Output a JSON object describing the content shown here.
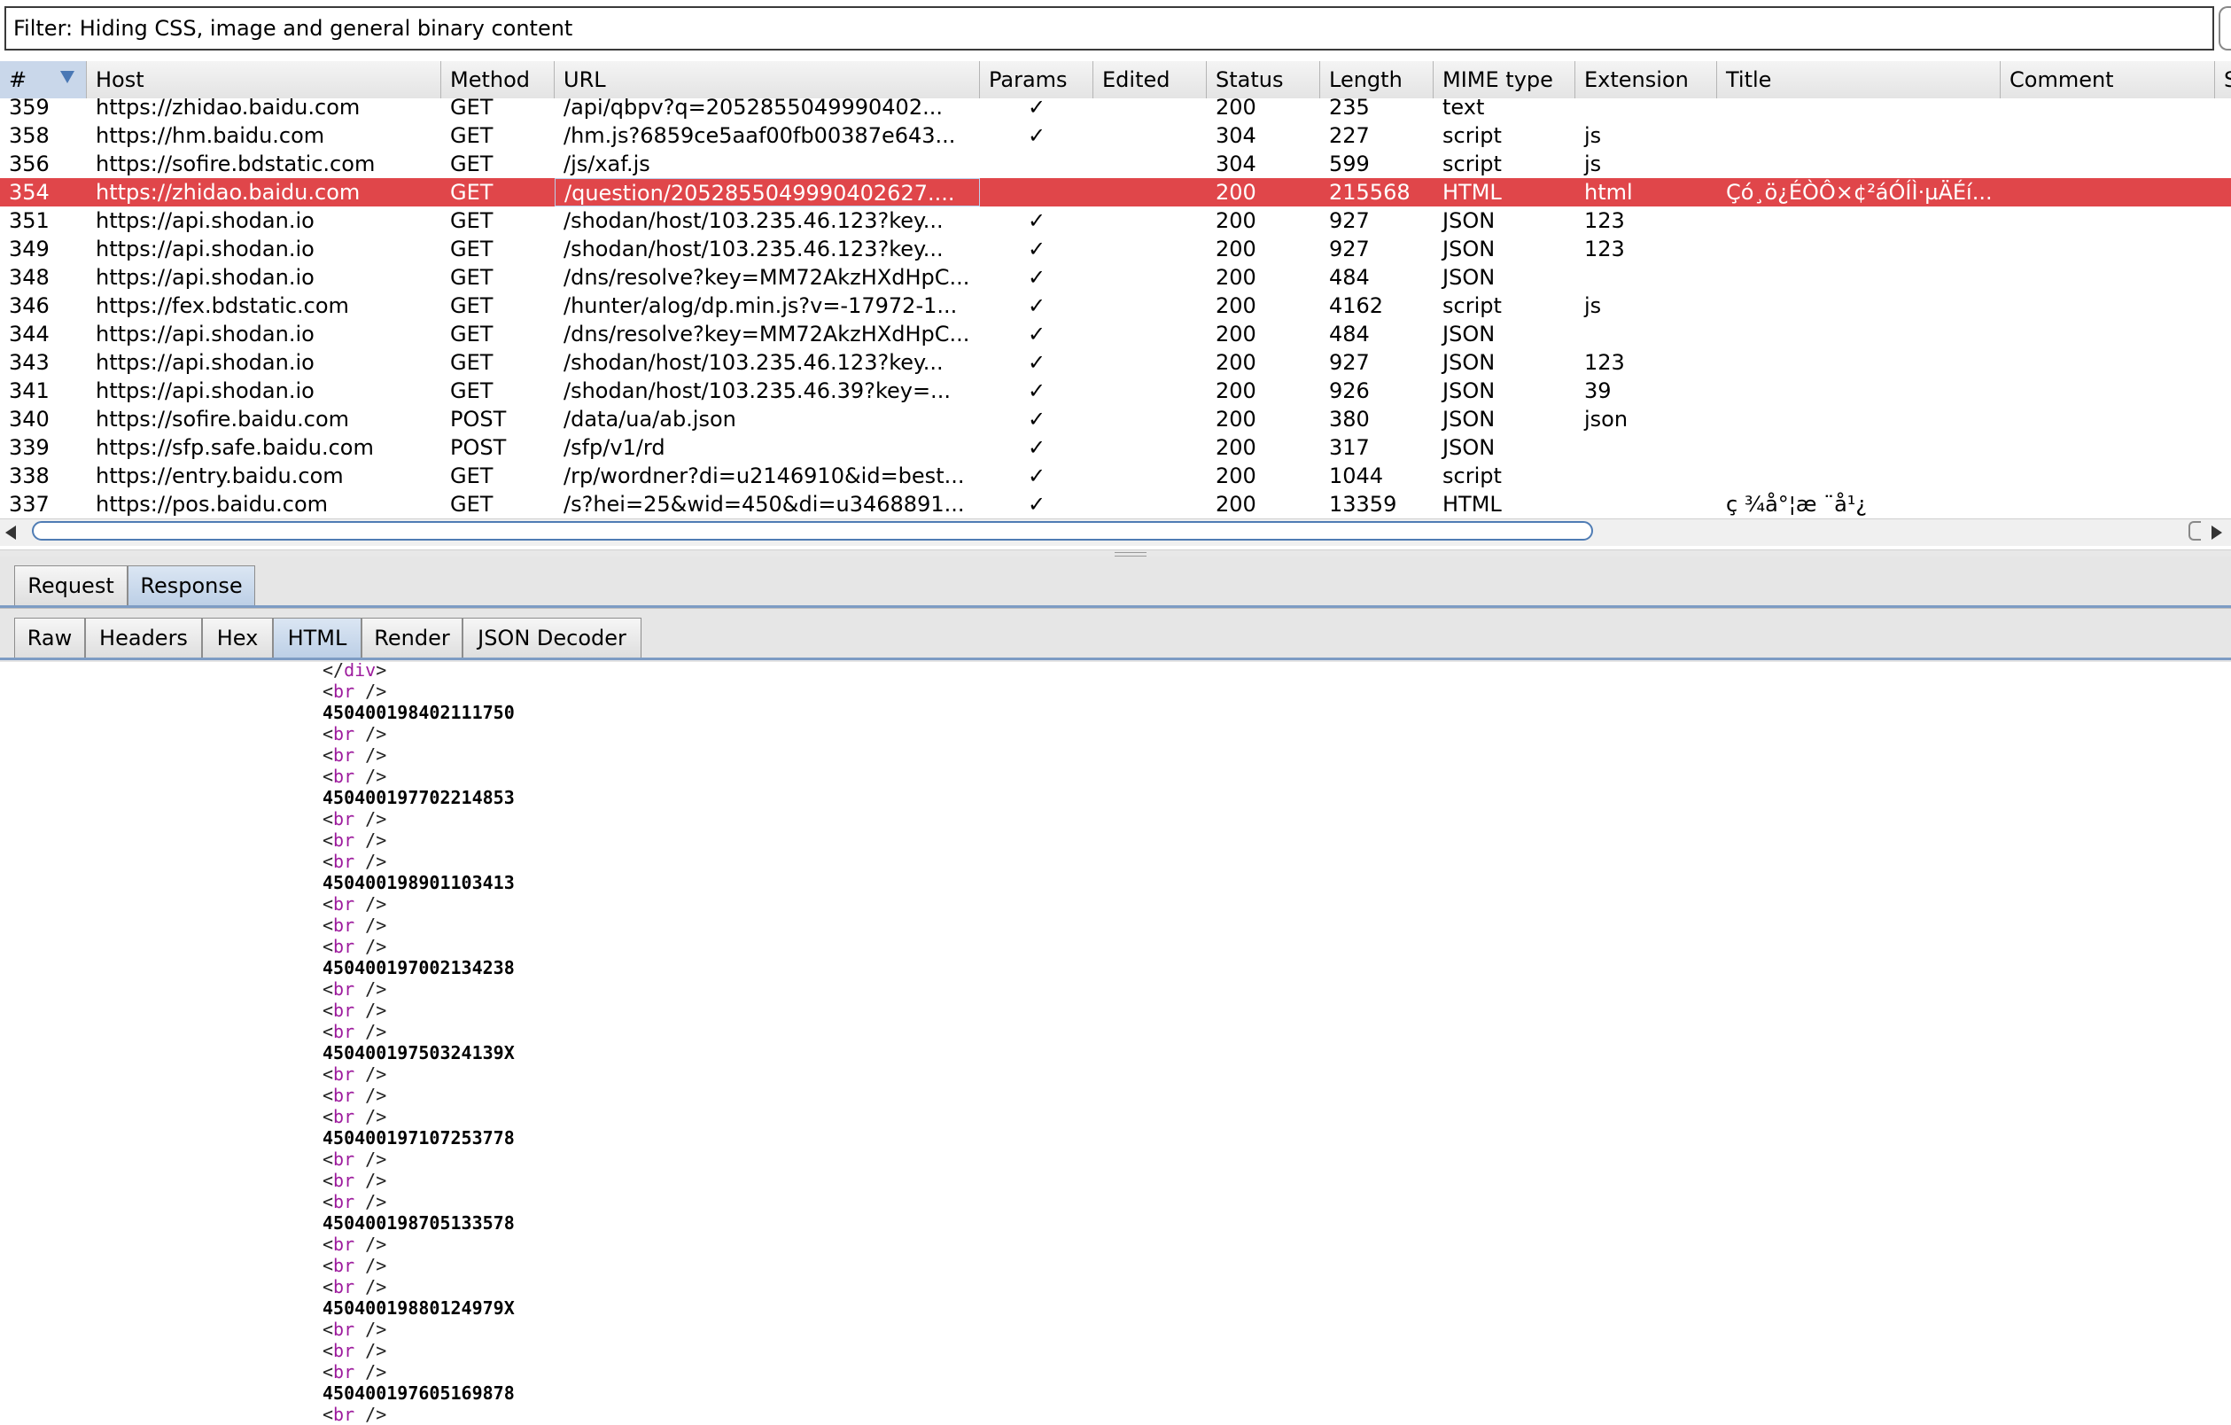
{
  "filter": {
    "text": "Filter: Hiding CSS, image and general binary content"
  },
  "table": {
    "columns": [
      {
        "key": "num",
        "label": "#"
      },
      {
        "key": "host",
        "label": "Host"
      },
      {
        "key": "method",
        "label": "Method"
      },
      {
        "key": "url",
        "label": "URL"
      },
      {
        "key": "params",
        "label": "Params"
      },
      {
        "key": "edited",
        "label": "Edited"
      },
      {
        "key": "status",
        "label": "Status"
      },
      {
        "key": "length",
        "label": "Length"
      },
      {
        "key": "mime",
        "label": "MIME type"
      },
      {
        "key": "extension",
        "label": "Extension"
      },
      {
        "key": "title",
        "label": "Title"
      },
      {
        "key": "comment",
        "label": "Comment"
      },
      {
        "key": "s",
        "label": "S"
      }
    ],
    "sort_icon": "sort-descending-icon",
    "rows": [
      {
        "num": "359",
        "host": "https://zhidao.baidu.com",
        "method": "GET",
        "url": "/api/qbpv?q=2052855049990402...",
        "params": "✓",
        "edited": "",
        "status": "200",
        "length": "235",
        "mime": "text",
        "extension": "",
        "title": "",
        "comment": ""
      },
      {
        "num": "358",
        "host": "https://hm.baidu.com",
        "method": "GET",
        "url": "/hm.js?6859ce5aaf00fb00387e643...",
        "params": "✓",
        "edited": "",
        "status": "304",
        "length": "227",
        "mime": "script",
        "extension": "js",
        "title": "",
        "comment": ""
      },
      {
        "num": "356",
        "host": "https://sofire.bdstatic.com",
        "method": "GET",
        "url": "/js/xaf.js",
        "params": "",
        "edited": "",
        "status": "304",
        "length": "599",
        "mime": "script",
        "extension": "js",
        "title": "",
        "comment": ""
      },
      {
        "num": "354",
        "host": "https://zhidao.baidu.com",
        "method": "GET",
        "url": "/question/2052855049990402627....",
        "params": "",
        "edited": "",
        "status": "200",
        "length": "215568",
        "mime": "HTML",
        "extension": "html",
        "title": "Çó¸ö¿ÉÒÔ×¢²áÓÍÌ·µÄÉí...",
        "comment": "",
        "selected": true
      },
      {
        "num": "351",
        "host": "https://api.shodan.io",
        "method": "GET",
        "url": "/shodan/host/103.235.46.123?key...",
        "params": "✓",
        "edited": "",
        "status": "200",
        "length": "927",
        "mime": "JSON",
        "extension": "123",
        "title": "",
        "comment": ""
      },
      {
        "num": "349",
        "host": "https://api.shodan.io",
        "method": "GET",
        "url": "/shodan/host/103.235.46.123?key...",
        "params": "✓",
        "edited": "",
        "status": "200",
        "length": "927",
        "mime": "JSON",
        "extension": "123",
        "title": "",
        "comment": ""
      },
      {
        "num": "348",
        "host": "https://api.shodan.io",
        "method": "GET",
        "url": "/dns/resolve?key=MM72AkzHXdHpC...",
        "params": "✓",
        "edited": "",
        "status": "200",
        "length": "484",
        "mime": "JSON",
        "extension": "",
        "title": "",
        "comment": ""
      },
      {
        "num": "346",
        "host": "https://fex.bdstatic.com",
        "method": "GET",
        "url": "/hunter/alog/dp.min.js?v=-17972-1...",
        "params": "✓",
        "edited": "",
        "status": "200",
        "length": "4162",
        "mime": "script",
        "extension": "js",
        "title": "",
        "comment": ""
      },
      {
        "num": "344",
        "host": "https://api.shodan.io",
        "method": "GET",
        "url": "/dns/resolve?key=MM72AkzHXdHpC...",
        "params": "✓",
        "edited": "",
        "status": "200",
        "length": "484",
        "mime": "JSON",
        "extension": "",
        "title": "",
        "comment": ""
      },
      {
        "num": "343",
        "host": "https://api.shodan.io",
        "method": "GET",
        "url": "/shodan/host/103.235.46.123?key...",
        "params": "✓",
        "edited": "",
        "status": "200",
        "length": "927",
        "mime": "JSON",
        "extension": "123",
        "title": "",
        "comment": ""
      },
      {
        "num": "341",
        "host": "https://api.shodan.io",
        "method": "GET",
        "url": "/shodan/host/103.235.46.39?key=...",
        "params": "✓",
        "edited": "",
        "status": "200",
        "length": "926",
        "mime": "JSON",
        "extension": "39",
        "title": "",
        "comment": ""
      },
      {
        "num": "340",
        "host": "https://sofire.baidu.com",
        "method": "POST",
        "url": "/data/ua/ab.json",
        "params": "✓",
        "edited": "",
        "status": "200",
        "length": "380",
        "mime": "JSON",
        "extension": "json",
        "title": "",
        "comment": ""
      },
      {
        "num": "339",
        "host": "https://sfp.safe.baidu.com",
        "method": "POST",
        "url": "/sfp/v1/rd",
        "params": "✓",
        "edited": "",
        "status": "200",
        "length": "317",
        "mime": "JSON",
        "extension": "",
        "title": "",
        "comment": ""
      },
      {
        "num": "338",
        "host": "https://entry.baidu.com",
        "method": "GET",
        "url": "/rp/wordner?di=u2146910&id=best...",
        "params": "✓",
        "edited": "",
        "status": "200",
        "length": "1044",
        "mime": "script",
        "extension": "",
        "title": "",
        "comment": ""
      },
      {
        "num": "337",
        "host": "https://pos.baidu.com",
        "method": "GET",
        "url": "/s?hei=25&wid=450&di=u3468891...",
        "params": "✓",
        "edited": "",
        "status": "200",
        "length": "13359",
        "mime": "HTML",
        "extension": "",
        "title": "ç  ¾å°¦æ   ¨å¹¿",
        "comment": ""
      }
    ]
  },
  "scrollbar": {
    "left_icon": "arrow-left-icon",
    "right_icon": "arrow-right-icon"
  },
  "tabs": {
    "primary": [
      "Request",
      "Response"
    ],
    "primary_active": "Response",
    "secondary": [
      "Raw",
      "Headers",
      "Hex",
      "HTML",
      "Render",
      "JSON Decoder"
    ],
    "secondary_active": "HTML"
  },
  "code": {
    "lines": [
      {
        "kind": "close",
        "tag": "div"
      },
      {
        "kind": "br"
      },
      {
        "kind": "text",
        "value": "450400198402111750"
      },
      {
        "kind": "br"
      },
      {
        "kind": "br"
      },
      {
        "kind": "br"
      },
      {
        "kind": "text",
        "value": "450400197702214853"
      },
      {
        "kind": "br"
      },
      {
        "kind": "br"
      },
      {
        "kind": "br"
      },
      {
        "kind": "text",
        "value": "450400198901103413"
      },
      {
        "kind": "br"
      },
      {
        "kind": "br"
      },
      {
        "kind": "br"
      },
      {
        "kind": "text",
        "value": "450400197002134238"
      },
      {
        "kind": "br"
      },
      {
        "kind": "br"
      },
      {
        "kind": "br"
      },
      {
        "kind": "text",
        "value": "45040019750324139X"
      },
      {
        "kind": "br"
      },
      {
        "kind": "br"
      },
      {
        "kind": "br"
      },
      {
        "kind": "text",
        "value": "450400197107253778"
      },
      {
        "kind": "br"
      },
      {
        "kind": "br"
      },
      {
        "kind": "br"
      },
      {
        "kind": "text",
        "value": "450400198705133578"
      },
      {
        "kind": "br"
      },
      {
        "kind": "br"
      },
      {
        "kind": "br"
      },
      {
        "kind": "text",
        "value": "45040019880124979X"
      },
      {
        "kind": "br"
      },
      {
        "kind": "br"
      },
      {
        "kind": "br"
      },
      {
        "kind": "text",
        "value": "450400197605169878"
      },
      {
        "kind": "br"
      }
    ]
  },
  "colors": {
    "selected_row": "#e0464a",
    "tag": "#9d1b9d",
    "accent": "#4f7cb4"
  }
}
